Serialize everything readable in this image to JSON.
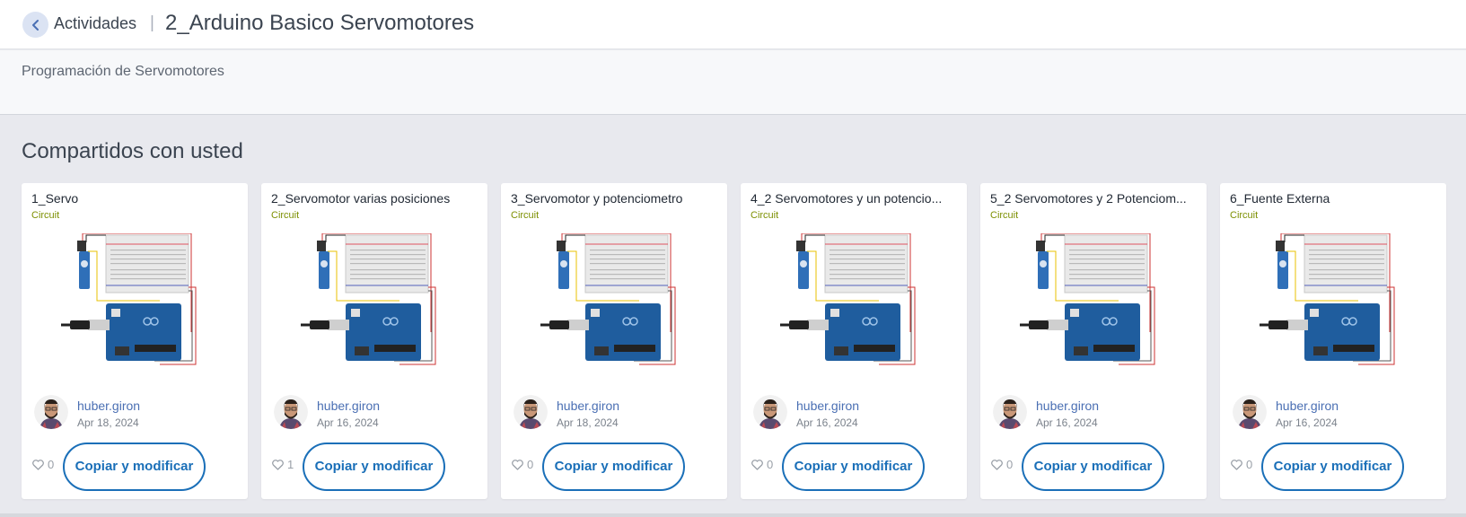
{
  "header": {
    "back_icon": "chevron-left-icon",
    "breadcrumb": "Actividades",
    "separator": "|",
    "title": "2_Arduino Basico Servomotores"
  },
  "description": "Programación de Servomotores",
  "section_title": "Compartidos con usted",
  "cards": [
    {
      "title": "1_Servo",
      "type": "Circuit",
      "author": "huber.giron",
      "date": "Apr 18, 2024",
      "likes": "0",
      "button": "Copiar y modificar"
    },
    {
      "title": "2_Servomotor varias posiciones",
      "type": "Circuit",
      "author": "huber.giron",
      "date": "Apr 16, 2024",
      "likes": "1",
      "button": "Copiar y modificar"
    },
    {
      "title": "3_Servomotor y potenciometro",
      "type": "Circuit",
      "author": "huber.giron",
      "date": "Apr 18, 2024",
      "likes": "0",
      "button": "Copiar y modificar"
    },
    {
      "title": "4_2 Servomotores y un potencio...",
      "type": "Circuit",
      "author": "huber.giron",
      "date": "Apr 16, 2024",
      "likes": "0",
      "button": "Copiar y modificar"
    },
    {
      "title": "5_2 Servomotores y 2 Potenciom...",
      "type": "Circuit",
      "author": "huber.giron",
      "date": "Apr 16, 2024",
      "likes": "0",
      "button": "Copiar y modificar"
    },
    {
      "title": "6_Fuente Externa",
      "type": "Circuit",
      "author": "huber.giron",
      "date": "Apr 16, 2024",
      "likes": "0",
      "button": "Copiar y modificar"
    }
  ],
  "colors": {
    "accent": "#1a6fb8",
    "circuit_tag": "#7c8f00",
    "author_link": "#4a6fb3"
  }
}
